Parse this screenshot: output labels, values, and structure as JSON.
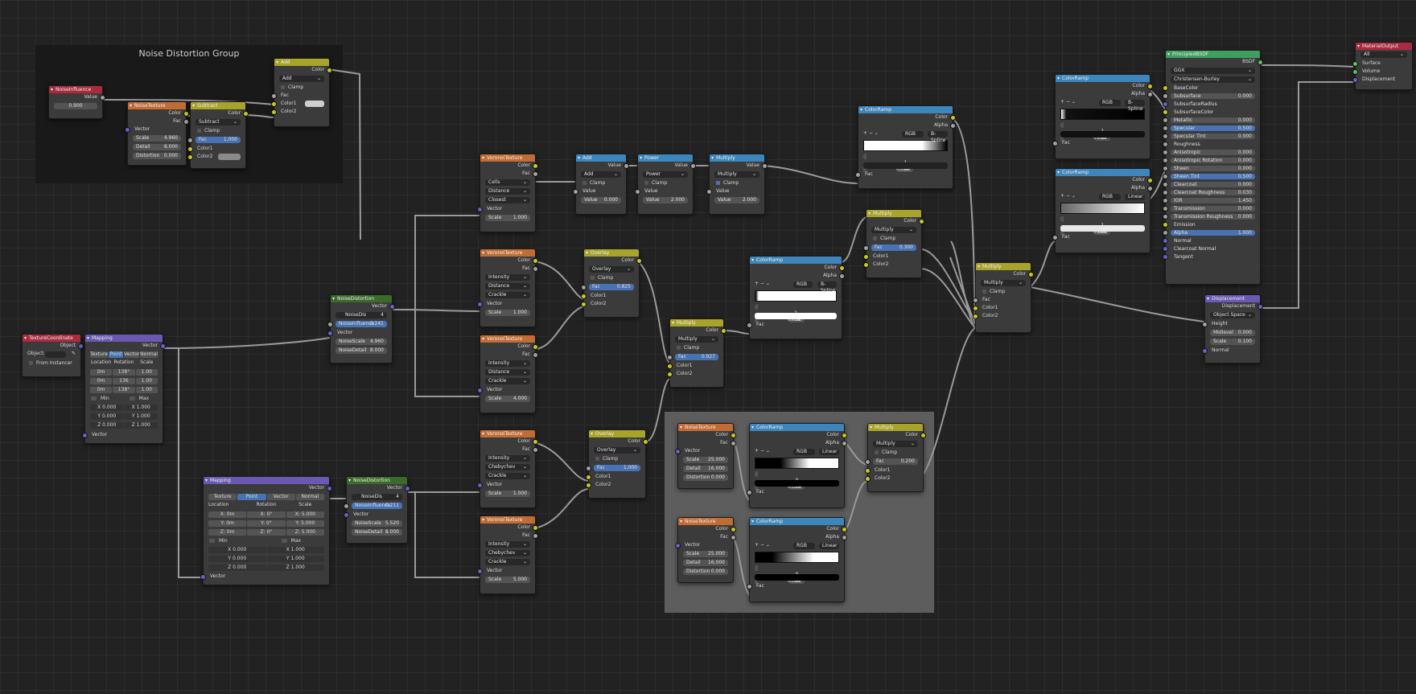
{
  "frames": {
    "noise_group_title": "Noise Distortion Group"
  },
  "colors": {
    "canvas": "#222222",
    "node_body": "#3b3b3b",
    "hdr_input": "#a82c3e",
    "hdr_texture": "#c26c35",
    "hdr_converter": "#3d86bc",
    "hdr_color": "#a8a32a",
    "hdr_vector": "#6a58b3",
    "hdr_group": "#3a6b2b",
    "hdr_shader": "#3f9f5f",
    "hdr_output": "#a82c3e",
    "socket_color": "#c7c729",
    "socket_float": "#a1a1a1",
    "socket_vector": "#6363c7",
    "socket_shader": "#b65ab6",
    "field_active": "#4772b3"
  },
  "nodes": {
    "noise_influence": {
      "title": "NoiseInfluence",
      "out": "Value",
      "value": "0.900"
    },
    "noise_texture_g": {
      "title": "NoiseTexture",
      "out1": "Color",
      "out2": "Fac",
      "in_vector": "Vector",
      "scale": "Scale",
      "scale_v": "4.960",
      "detail": "Detail",
      "detail_v": "8.000",
      "distortion": "Distortion",
      "distortion_v": "0.000"
    },
    "subtract": {
      "title": "Subtract",
      "out": "Color",
      "mode": "Subtract",
      "clamp": "Clamp",
      "fac": "Fac",
      "fac_v": "1.000",
      "color1": "Color1",
      "color2": "Color2"
    },
    "add_g": {
      "title": "Add",
      "out": "Color",
      "mode": "Add",
      "clamp": "Clamp",
      "fac": "Fac",
      "color1": "Color1",
      "color2": "Color2"
    },
    "tex_coord": {
      "title": "TextureCoordinate",
      "out": "Object",
      "object": "Object:",
      "from_instancer": "From Instancer"
    },
    "mapping1": {
      "title": "Mapping",
      "out": "Vector",
      "type_tabs": [
        "Texture",
        "Point",
        "Vector",
        "Normal"
      ],
      "col_heads": [
        "Location",
        "Rotation",
        "Scale"
      ],
      "rows": [
        [
          "0m",
          "138°",
          "1.00"
        ],
        [
          "0m",
          "136",
          "1.00"
        ],
        [
          "0m",
          "138°",
          "1.00"
        ]
      ],
      "min": "Min",
      "max": "Max",
      "min_rows": [
        [
          "X",
          "0.000"
        ],
        [
          "Y",
          "0.000"
        ],
        [
          "Z",
          "0.000"
        ]
      ],
      "max_rows": [
        [
          "X",
          "1.000"
        ],
        [
          "Y",
          "1.000"
        ],
        [
          "Z",
          "1.000"
        ]
      ],
      "in_vector": "Vector"
    },
    "mapping2": {
      "title": "Mapping",
      "out": "Vector",
      "type_tabs": [
        "Texture",
        "Point",
        "Vector",
        "Normal"
      ],
      "col_heads": [
        "Location",
        "Rotation",
        "Scale"
      ],
      "rows": [
        [
          "X:",
          "0m",
          "X:",
          "0°",
          "X:",
          "5.000"
        ],
        [
          "Y:",
          "0m",
          "Y:",
          "0°",
          "Y:",
          "5.000"
        ],
        [
          "Z:",
          "0m",
          "Z:",
          "0°",
          "Z:",
          "5.000"
        ]
      ],
      "min": "Min",
      "max": "Max",
      "min_rows": [
        [
          "X",
          "0.000"
        ],
        [
          "Y",
          "0.000"
        ],
        [
          "Z",
          "0.000"
        ]
      ],
      "max_rows": [
        [
          "X",
          "1.000"
        ],
        [
          "Y",
          "1.000"
        ],
        [
          "Z",
          "1.000"
        ]
      ],
      "in_vector": "Vector"
    },
    "noise_dist1": {
      "title": "NoiseDistortion",
      "out": "Vector",
      "group": "NoiseDis",
      "users": "4",
      "influence": "NoiseInfluence",
      "influence_v": "0.241",
      "vector": "Vector",
      "nscale": "NoiseScale",
      "nscale_v": "4.960",
      "ndetail": "NoiseDetail",
      "ndetail_v": "8.000"
    },
    "noise_dist2": {
      "title": "NoiseDistortion",
      "out": "Vector",
      "group": "NoiseDis",
      "users": "4",
      "influence": "NoiseInfluence",
      "influence_v": "0.211",
      "vector": "Vector",
      "nscale": "NoiseScale",
      "nscale_v": "5.520",
      "ndetail": "NoiseDetail",
      "ndetail_v": "8.000"
    },
    "voronoi1": {
      "title": "VoronoiTexture",
      "out1": "Color",
      "out2": "Fac",
      "dd": [
        "Cells",
        "Distance",
        "Closest"
      ],
      "vector": "Vector",
      "scale": "Scale",
      "scale_v": "1.000"
    },
    "voronoi2": {
      "title": "VoronoiTexture",
      "out1": "Color",
      "out2": "Fac",
      "dd": [
        "Intensity",
        "Distance",
        "Crackle"
      ],
      "vector": "Vector",
      "scale": "Scale",
      "scale_v": "1.000"
    },
    "voronoi3": {
      "title": "VoronoiTexture",
      "out1": "Color",
      "out2": "Fac",
      "dd": [
        "Intensity",
        "Distance",
        "Crackle"
      ],
      "vector": "Vector",
      "scale": "Scale",
      "scale_v": "4.000"
    },
    "voronoi4": {
      "title": "VoronoiTexture",
      "out1": "Color",
      "out2": "Fac",
      "dd": [
        "Intensity",
        "Chebychev",
        "Crackle"
      ],
      "vector": "Vector",
      "scale": "Scale",
      "scale_v": "1.000"
    },
    "voronoi5": {
      "title": "VoronoiTexture",
      "out1": "Color",
      "out2": "Fac",
      "dd": [
        "Intensity",
        "Chebychev",
        "Crackle"
      ],
      "vector": "Vector",
      "scale": "Scale",
      "scale_v": "5.000"
    },
    "math_add": {
      "title": "Add",
      "out": "Value",
      "mode": "Add",
      "clamp": "Clamp",
      "in": "Value",
      "val": "Value",
      "val_v": "0.000"
    },
    "math_power": {
      "title": "Power",
      "out": "Value",
      "mode": "Power",
      "clamp": "Clamp",
      "in": "Value",
      "val": "Value",
      "val_v": "2.000"
    },
    "math_mult": {
      "title": "Multiply",
      "out": "Value",
      "mode": "Multiply",
      "clamp": "Clamp",
      "in": "Value",
      "val": "Value",
      "val_v": "2.000"
    },
    "overlay1": {
      "title": "Overlay",
      "out": "Color",
      "mode": "Overlay",
      "clamp": "Clamp",
      "fac": "Fac",
      "fac_v": "0.825",
      "color1": "Color1",
      "color2": "Color2"
    },
    "overlay2": {
      "title": "Overlay",
      "out": "Color",
      "mode": "Overlay",
      "clamp": "Clamp",
      "fac": "Fac",
      "fac_v": "1.000",
      "color1": "Color1",
      "color2": "Color2"
    },
    "mult_mid": {
      "title": "Multiply",
      "out": "Color",
      "mode": "Multiply",
      "clamp": "Clamp",
      "fac": "Fac",
      "fac_v": "0.927",
      "color1": "Color1",
      "color2": "Color2"
    },
    "ramp_mid": {
      "title": "ColorRamp",
      "out1": "Color",
      "out2": "Alpha",
      "mode": "RGB",
      "interp": "B-Spline",
      "idx": "2",
      "pos": "Pos:",
      "pos_v": "0.032",
      "fac": "Fac"
    },
    "ramp_top": {
      "title": "ColorRamp",
      "out1": "Color",
      "out2": "Alpha",
      "mode": "RGB",
      "interp": "B-Spline",
      "idx": "1",
      "pos": "Pos:",
      "pos_v": "0.764",
      "fac": "Fac"
    },
    "mult_top": {
      "title": "Multiply",
      "out": "Color",
      "mode": "Multiply",
      "clamp": "Clamp",
      "fac": "Fac",
      "fac_v": "0.300",
      "color1": "Color1",
      "color2": "Color2"
    },
    "ramp_r1": {
      "title": "ColorRamp",
      "out1": "Color",
      "out2": "Alpha",
      "mode": "RGB",
      "interp": "B-Spline",
      "idx": "1",
      "pos": "Pos:",
      "pos_v": "0.067",
      "fac": "Fac"
    },
    "ramp_r2": {
      "title": "ColorRamp",
      "out1": "Color",
      "out2": "Alpha",
      "mode": "RGB",
      "interp": "Linear",
      "idx": "1",
      "pos": "Pos:",
      "pos_v": "0.808",
      "fac": "Fac"
    },
    "mult_right": {
      "title": "Multiply",
      "out": "Color",
      "mode": "Multiply",
      "clamp": "Clamp",
      "fac": "Fac",
      "color1": "Color1",
      "color2": "Color2"
    },
    "principled": {
      "title": "PrincipledBSDF",
      "out": "BSDF",
      "dist": "GGX",
      "sss": "Christensen-Burley",
      "rows": [
        [
          "BaseColor",
          ""
        ],
        [
          "Subsurface",
          "0.000"
        ],
        [
          "SubsurfaceRadius",
          ""
        ],
        [
          "SubsurfaceColor",
          ""
        ],
        [
          "Metallic",
          "0.000"
        ],
        [
          "Specular",
          "0.500"
        ],
        [
          "Specular Tint",
          "0.000"
        ],
        [
          "Roughness",
          ""
        ],
        [
          "Anisotropic",
          "0.000"
        ],
        [
          "Anisotropic Rotation",
          "0.000"
        ],
        [
          "Sheen",
          "0.000"
        ],
        [
          "Sheen Tint",
          "0.500"
        ],
        [
          "Clearcoat",
          "0.000"
        ],
        [
          "Clearcoat Roughness",
          "0.030"
        ],
        [
          "IOR",
          "1.450"
        ],
        [
          "Transmission",
          "0.000"
        ],
        [
          "Transmission Roughness",
          "0.000"
        ],
        [
          "Emission",
          ""
        ],
        [
          "Alpha",
          "1.000"
        ],
        [
          "Normal",
          ""
        ],
        [
          "Clearcoat Normal",
          ""
        ],
        [
          "Tangent",
          ""
        ]
      ]
    },
    "mat_out": {
      "title": "MaterialOutput",
      "target": "All",
      "surface": "Surface",
      "volume": "Volume",
      "displacement": "Displacement"
    },
    "displacement": {
      "title": "Displacement",
      "out": "Displacement",
      "space": "Object Space",
      "height": "Height",
      "midlevel": "Midlevel",
      "midlevel_v": "0.000",
      "scale": "Scale",
      "scale_v": "0.100",
      "normal": "Normal"
    },
    "nt_b1": {
      "title": "NoiseTexture",
      "out1": "Color",
      "out2": "Fac",
      "vector": "Vector",
      "scale": "Scale",
      "scale_v": "25.000",
      "detail": "Detail",
      "detail_v": "16.000",
      "distortion": "Distortion",
      "distortion_v": "0.000"
    },
    "nt_b2": {
      "title": "NoiseTexture",
      "out1": "Color",
      "out2": "Fac",
      "vector": "Vector",
      "scale": "Scale",
      "scale_v": "25.000",
      "detail": "Detail",
      "detail_v": "16.000",
      "distortion": "Distortion",
      "distortion_v": "0.000"
    },
    "ramp_b1": {
      "title": "ColorRamp",
      "out1": "Color",
      "out2": "Alpha",
      "mode": "RGB",
      "interp": "Linear",
      "idx": "0",
      "pos": "Pos:",
      "pos_v": "0.314",
      "fac": "Fac"
    },
    "ramp_b2": {
      "title": "ColorRamp",
      "out1": "Color",
      "out2": "Alpha",
      "mode": "RGB",
      "interp": "Linear",
      "idx": "0",
      "pos": "Pos:",
      "pos_v": "0.382",
      "fac": "Fac"
    },
    "mult_b": {
      "title": "Multiply",
      "out": "Color",
      "mode": "Multiply",
      "clamp": "Clamp",
      "fac": "Fac",
      "fac_v": "0.200",
      "color1": "Color1",
      "color2": "Color2"
    }
  }
}
